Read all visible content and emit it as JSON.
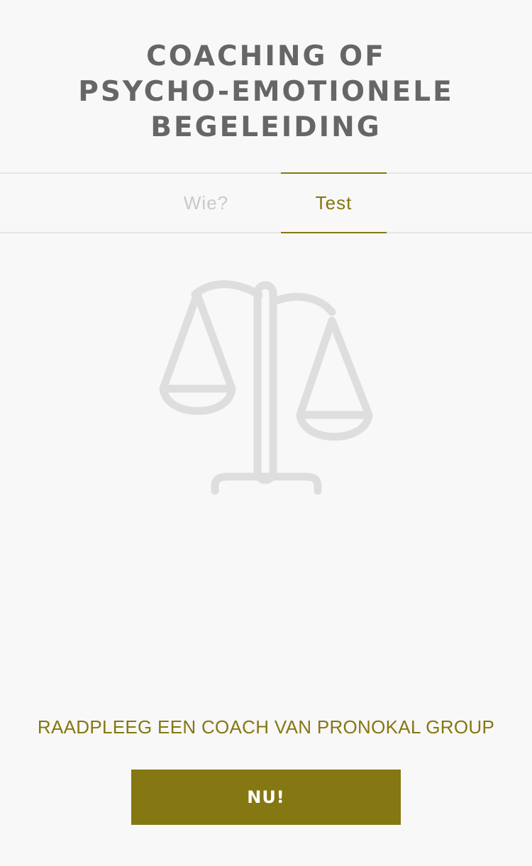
{
  "header": {
    "title_lines": [
      "COACHING OF",
      "PSYCHO-EMOTIONELE",
      "BEGELEIDING"
    ]
  },
  "tabs": [
    {
      "label": "Wie?",
      "active": false
    },
    {
      "label": "Test",
      "active": true
    }
  ],
  "illustration": {
    "icon": "balance-scale-icon",
    "color": "#dedede"
  },
  "cta": {
    "text": "RAADPLEEG EEN COACH VAN PRONOKAL GROUP",
    "button_label": "NU!"
  },
  "colors": {
    "accent": "#857711",
    "title": "#666666",
    "inactive_tab": "#c9c9c9",
    "background": "#f8f8f8"
  }
}
